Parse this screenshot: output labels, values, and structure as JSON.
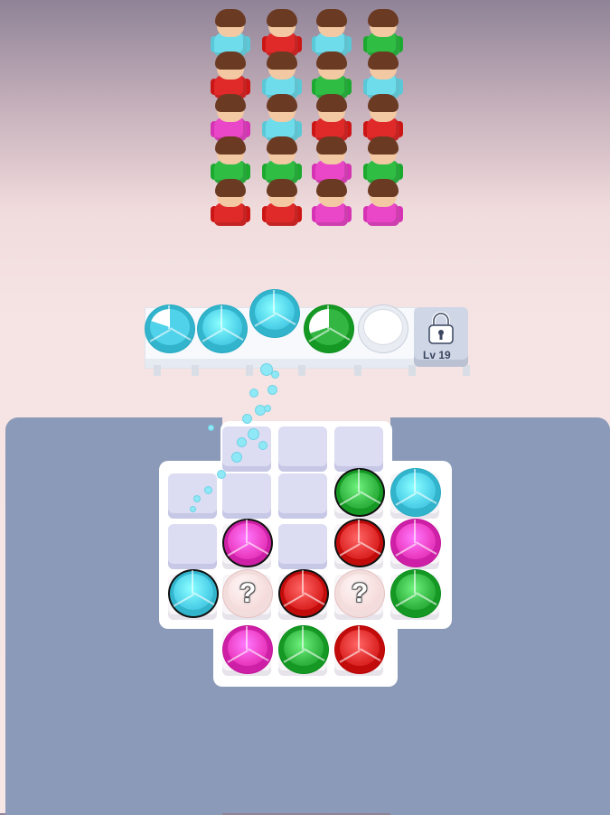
{
  "colors": {
    "cyan": "#4fd2ea",
    "red": "#e02a2a",
    "green": "#33b642",
    "pink": "#ec3ec4",
    "shirt_cyan": "#6fdcec",
    "shirt_red": "#e02a2a",
    "shirt_green": "#2fbd44",
    "shirt_pink": "#ea47c8"
  },
  "crowd": [
    [
      "cyan",
      "red",
      "cyan",
      "green"
    ],
    [
      "red",
      "cyan",
      "green",
      "cyan"
    ],
    [
      "pink",
      "cyan",
      "red",
      "red"
    ],
    [
      "green",
      "green",
      "pink",
      "green"
    ],
    [
      "red",
      "red",
      "pink",
      "pink"
    ]
  ],
  "tray": {
    "slots": [
      {
        "color": "cyan",
        "fill": 0.8
      },
      {
        "color": "cyan",
        "fill": 1.0
      },
      {
        "color": "cyan",
        "fill": 1.0,
        "lifted": true
      },
      {
        "color": "green",
        "fill": 0.7
      },
      {
        "color": "empty",
        "fill": 0
      }
    ],
    "lock": {
      "icon": "padlock-icon",
      "label": "Lv 19"
    }
  },
  "board": {
    "rows": [
      [
        "blank",
        "cell",
        "cell",
        "cell",
        "blank"
      ],
      [
        "cell",
        "cell",
        "cell",
        "green",
        "cyan"
      ],
      [
        "cell",
        "pink",
        "cell",
        "red",
        "pink"
      ],
      [
        "cyan",
        "mystery",
        "red",
        "mystery",
        "green"
      ],
      [
        "blank",
        "pink",
        "green",
        "red",
        "blank"
      ]
    ],
    "mystery_label": "?"
  }
}
